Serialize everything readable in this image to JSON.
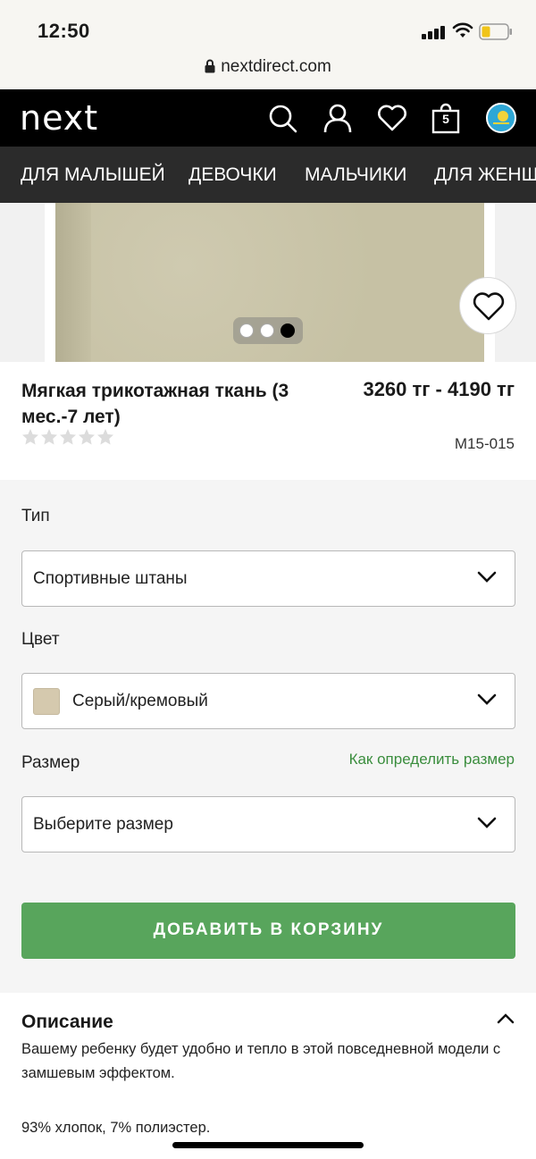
{
  "status_bar": {
    "time": "12:50"
  },
  "url_bar": {
    "url": "nextdirect.com"
  },
  "header": {
    "logo": "next",
    "icons": [
      "search-icon",
      "account-icon",
      "favourites-icon",
      "bag-icon",
      "country-flag-icon"
    ],
    "bag_count": "5"
  },
  "nav": {
    "items": [
      "ДЛЯ МАЛЫШЕЙ",
      "ДЕВОЧКИ",
      "МАЛЬЧИКИ",
      "ДЛЯ ЖЕНЩ"
    ]
  },
  "gallery": {
    "dots_total": 3,
    "active_dot": 3
  },
  "product": {
    "title": "Мягкая трикотажная ткань (3 мес.-7 лет)",
    "rating_stars": 5,
    "rating_value": 0,
    "price": "3260 тг - 4190 тг",
    "code": "M15-015"
  },
  "options": {
    "type_label": "Тип",
    "type_value": "Спортивные штаны",
    "color_label": "Цвет",
    "color_value": "Серый/кремовый",
    "color_swatch": "#d5c9ae",
    "size_label": "Размер",
    "size_help": "Как определить размер",
    "size_placeholder": "Выберите размер",
    "add_to_bag": "ДОБАВИТЬ В КОРЗИНУ"
  },
  "description": {
    "title": "Описание",
    "text": "Вашему ребенку будет удобно и тепло в этой повседневной модели с замшевым эффектом.",
    "composition": "93% хлопок, 7% полиэстер."
  },
  "colors": {
    "accent_green": "#58a55c",
    "link_green": "#3a8d3d",
    "header_bg": "#000000",
    "nav_bg": "#2b2b2b"
  }
}
